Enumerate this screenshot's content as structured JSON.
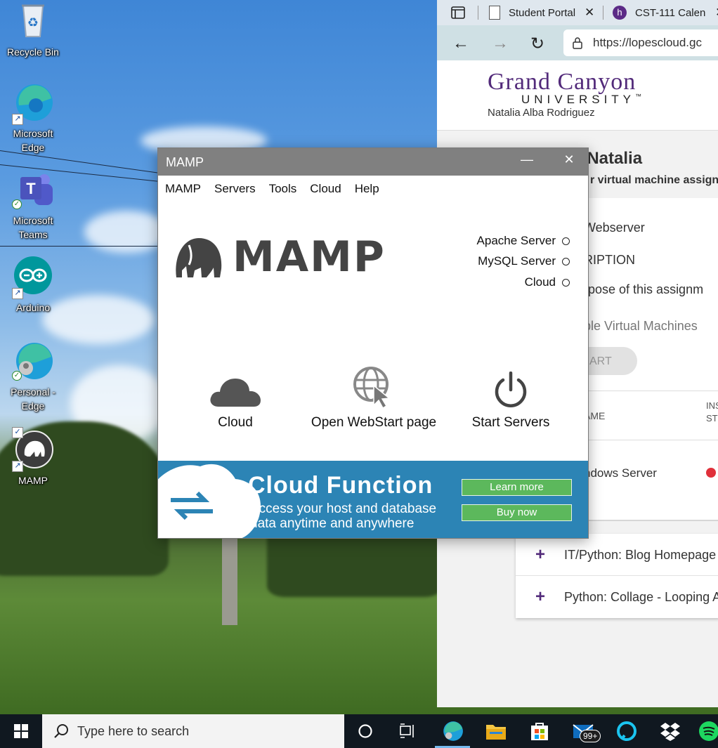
{
  "desktop": {
    "icons": [
      {
        "label": "Recycle Bin",
        "icon": "recycle-bin-icon"
      },
      {
        "label": "Microsoft Edge",
        "icon": "edge-icon"
      },
      {
        "label": "Microsoft Teams",
        "icon": "teams-icon"
      },
      {
        "label": "Arduino",
        "icon": "arduino-icon"
      },
      {
        "label": "Personal - Edge",
        "icon": "edge-profile-icon"
      },
      {
        "label": "MAMP",
        "icon": "mamp-icon"
      }
    ]
  },
  "browser": {
    "tabs": [
      {
        "label": "Student Portal"
      },
      {
        "label": "CST-111 Calen"
      }
    ],
    "url": "https://lopescloud.gc",
    "header": {
      "university_line1": "Grand Canyon",
      "university_line2": "UNIVERSITY",
      "tm": "™",
      "user_name": "Natalia Alba Rodriguez"
    },
    "greeting": ", Natalia",
    "greeting_sub": "r virtual machine assignm",
    "assignment_title": "Webserver",
    "description_heading": "RIPTION",
    "purpose_text": "rpose of this assignm",
    "vm_heading": "ble Virtual Machines",
    "start_button": "ART",
    "table": {
      "col_name": "AME",
      "col_ins_1": "INS",
      "col_ins_2": "ST",
      "row_name": "ndows Server",
      "row_status_color": "#e0303a"
    },
    "assignments": [
      {
        "plus": "+",
        "label": "IT/Python: Blog Homepage"
      },
      {
        "plus": "+",
        "label": "Python: Collage - Looping A"
      }
    ]
  },
  "mamp": {
    "window_title": "MAMP",
    "minimize": "—",
    "close": "✕",
    "menu": [
      "MAMP",
      "Servers",
      "Tools",
      "Cloud",
      "Help"
    ],
    "brand": "MAMP",
    "servers": [
      {
        "label": "Apache Server"
      },
      {
        "label": "MySQL Server"
      },
      {
        "label": "Cloud"
      }
    ],
    "actions": {
      "cloud": "Cloud",
      "webstart": "Open WebStart page",
      "start": "Start Servers"
    },
    "banner": {
      "headline": "Cloud Function",
      "line1": "Access your host and database",
      "line2": "data anytime and anywhere",
      "learn_more": "Learn more",
      "buy_now": "Buy now"
    }
  },
  "taskbar": {
    "search_placeholder": "Type here to search",
    "mail_badge": "99+"
  },
  "colors": {
    "gcu_purple": "#522a7a",
    "mamp_banner": "#2c84b5",
    "mamp_button_green": "#5cb85c",
    "taskbar": "#101820"
  }
}
